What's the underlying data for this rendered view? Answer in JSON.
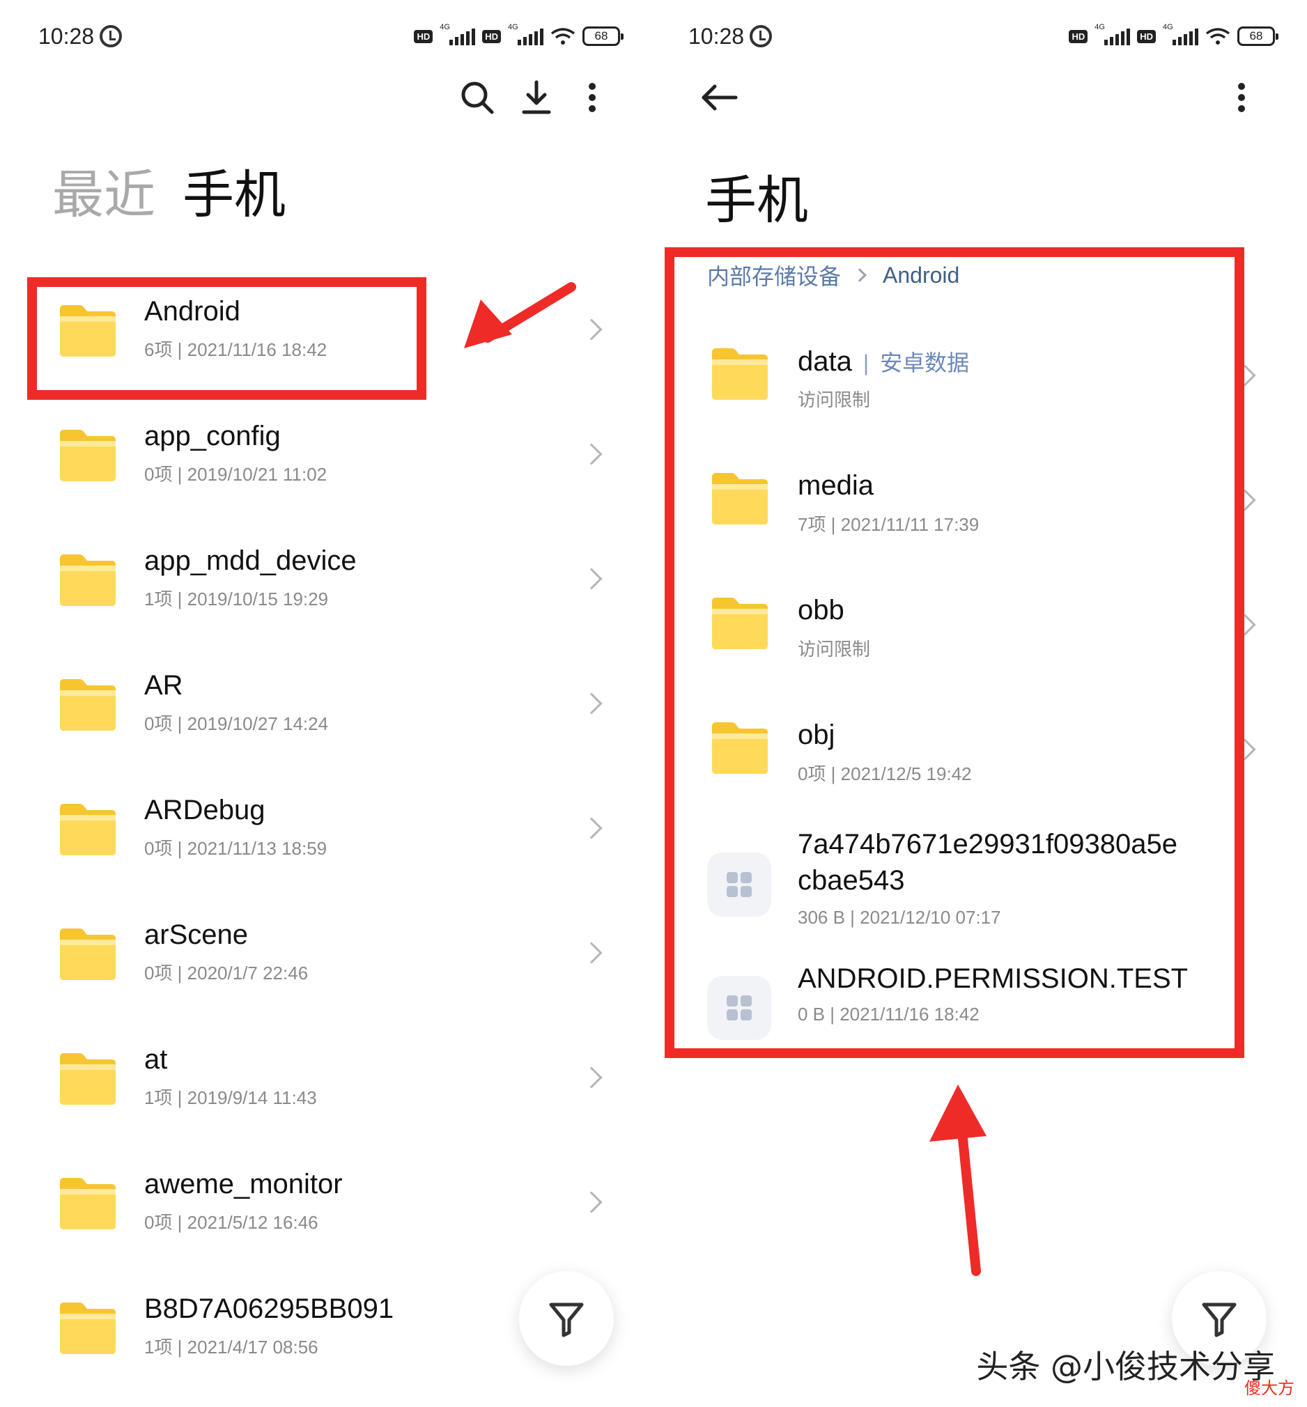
{
  "left": {
    "status": {
      "time": "10:28",
      "battery": "68",
      "net": "4G",
      "hd": "HD"
    },
    "tabs": {
      "recent": "最近",
      "phone": "手机"
    },
    "files": [
      {
        "name": "Android",
        "meta": "6项  |  2021/11/16 18:42"
      },
      {
        "name": "app_config",
        "meta": "0项  |  2019/10/21 11:02"
      },
      {
        "name": "app_mdd_device",
        "meta": "1项  |  2019/10/15 19:29"
      },
      {
        "name": "AR",
        "meta": "0项  |  2019/10/27 14:24"
      },
      {
        "name": "ARDebug",
        "meta": "0项  |  2021/11/13 18:59"
      },
      {
        "name": "arScene",
        "meta": "0项  |  2020/1/7 22:46"
      },
      {
        "name": "at",
        "meta": "1项  |  2019/9/14 11:43"
      },
      {
        "name": "aweme_monitor",
        "meta": "0项  |  2021/5/12 16:46"
      },
      {
        "name": "B8D7A06295BB091",
        "meta": "1项  |  2021/4/17 08:56"
      }
    ]
  },
  "right": {
    "status": {
      "time": "10:28",
      "battery": "68",
      "net": "4G",
      "hd": "HD"
    },
    "title": "手机",
    "breadcrumb": {
      "root": "内部存储设备",
      "current": "Android"
    },
    "files": [
      {
        "name": "data",
        "sep": "|",
        "tag": "安卓数据",
        "meta": "访问限制"
      },
      {
        "name": "media",
        "meta": "7项  |  2021/11/11 17:39"
      },
      {
        "name": "obb",
        "meta": "访问限制"
      },
      {
        "name": "obj",
        "meta": "0项  |  2021/12/5 19:42"
      },
      {
        "name_line1": "7a474b7671e29931f09380a5e",
        "name_line2": "cbae543",
        "meta": "306 B  |  2021/12/10 07:17"
      },
      {
        "name": "ANDROID.PERMISSION.TEST",
        "meta": "0 B  |  2021/11/16 18:42"
      }
    ]
  },
  "watermark": {
    "main": "头条 @小俊技术分享",
    "sub": "傻大方"
  },
  "colors": {
    "highlight": "#ef2b28",
    "folder": "#ffd54f",
    "breadcrumb": "#5c7ba8"
  },
  "icons": [
    "search-icon",
    "download-icon",
    "more-vert-icon",
    "back-arrow-icon",
    "filter-icon",
    "folder-icon",
    "file-icon",
    "alarm-icon",
    "wifi-icon",
    "battery-icon"
  ]
}
